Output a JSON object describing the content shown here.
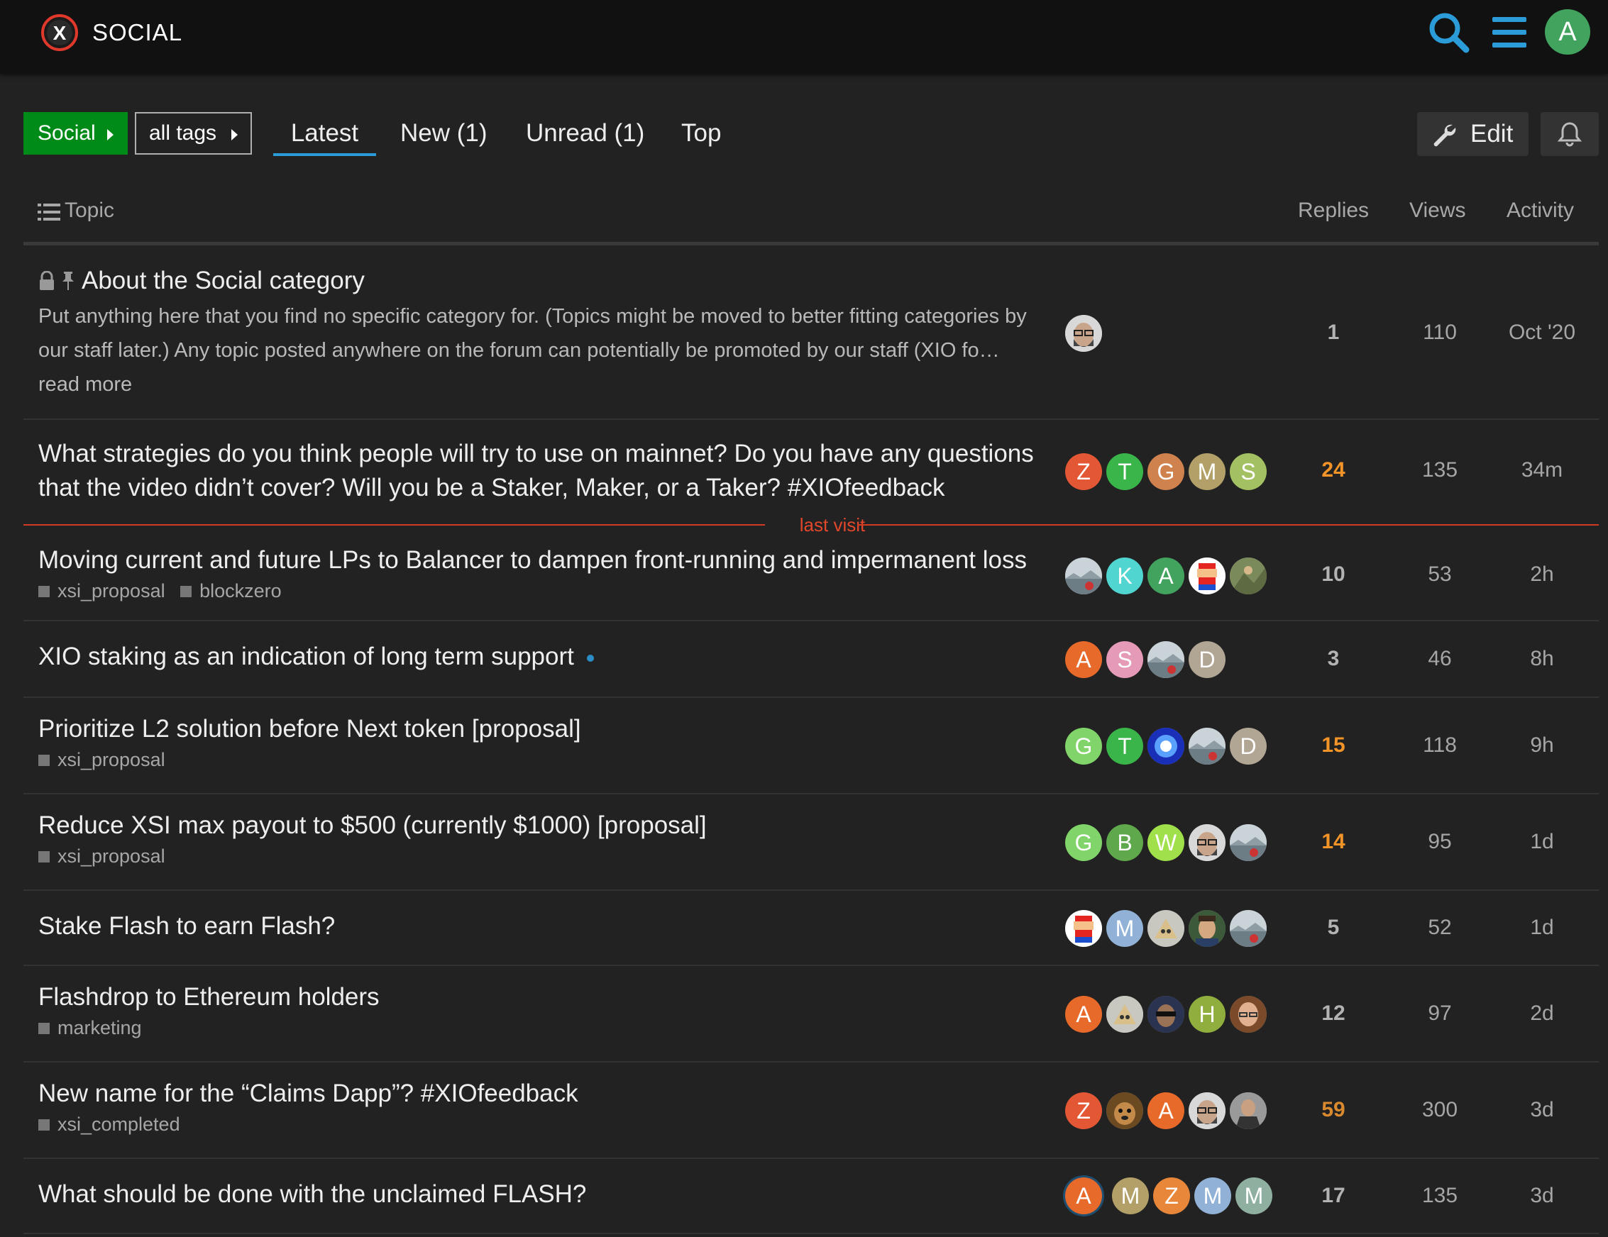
{
  "header": {
    "site_title": "SOCIAL",
    "logo_letter": "X",
    "user_initial": "A",
    "icons": [
      "search-icon",
      "hamburger-menu-icon"
    ],
    "accent_color": "#2b9cd8"
  },
  "nav": {
    "category": "Social",
    "tags": "all tags",
    "tabs": [
      "Latest",
      "New (1)",
      "Unread (1)",
      "Top"
    ],
    "active_tab": "Latest",
    "edit_label": "Edit"
  },
  "columns": {
    "topic": "Topic",
    "replies": "Replies",
    "views": "Views",
    "activity": "Activity"
  },
  "last_visit_label": "last visit",
  "topics": [
    {
      "title": "About the Social category",
      "excerpt": "Put anything here that you find no specific category for. (Topics might be moved to better fitting categories by our staff later.) Any topic posted anywhere on the forum can potentially be promoted by our staff (XIO fo… read more",
      "replies": "1",
      "views": "110",
      "activity": "Oct '20",
      "posters": [
        {
          "type": "image",
          "name": "glasses-beard-avatar"
        }
      ]
    },
    {
      "title": "What strategies do you think people will try to use on mainnet? Do you have any questions that the video didn’t cover? Will you be a Staker, Maker, or a Taker? #XIOfeedback",
      "replies": "24",
      "views": "135",
      "activity": "34m",
      "posters": [
        {
          "letter": "Z",
          "color": "#e45735"
        },
        {
          "letter": "T",
          "color": "#3ab54a"
        },
        {
          "letter": "G",
          "color": "#d0824e"
        },
        {
          "letter": "M",
          "color": "#b3a068"
        },
        {
          "letter": "S",
          "color": "#a3c163"
        }
      ]
    },
    {
      "title": "Moving current and future LPs to Balancer to dampen front-running and impermanent loss",
      "tags": [
        "xsi_proposal",
        "blockzero"
      ],
      "replies": "10",
      "views": "53",
      "activity": "2h",
      "posters": [
        {
          "type": "image",
          "name": "landscape-avatar"
        },
        {
          "letter": "K",
          "color": "#50d5d1"
        },
        {
          "letter": "A",
          "color": "#41a35e"
        },
        {
          "type": "image",
          "name": "pixel-mario-avatar"
        },
        {
          "type": "image",
          "name": "rock-climber-avatar"
        }
      ]
    },
    {
      "title": "XIO staking as an indication of long term support",
      "replies": "3",
      "views": "46",
      "activity": "8h",
      "posters": [
        {
          "letter": "A",
          "color": "#e86a2b"
        },
        {
          "letter": "S",
          "color": "#e59ab7"
        },
        {
          "type": "image",
          "name": "landscape-avatar"
        },
        {
          "letter": "D",
          "color": "#b1a593"
        }
      ]
    },
    {
      "title": "Prioritize L2 solution before Next token [proposal]",
      "tags": [
        "xsi_proposal"
      ],
      "replies": "15",
      "views": "118",
      "activity": "9h",
      "posters": [
        {
          "letter": "G",
          "color": "#81d46a"
        },
        {
          "letter": "T",
          "color": "#3ab54a"
        },
        {
          "type": "image",
          "name": "blue-swirl-avatar"
        },
        {
          "type": "image",
          "name": "landscape-avatar"
        },
        {
          "letter": "D",
          "color": "#b1a593"
        }
      ]
    },
    {
      "title": "Reduce XSI max payout to $500 (currently $1000) [proposal]",
      "tags": [
        "xsi_proposal"
      ],
      "replies": "14",
      "views": "95",
      "activity": "1d",
      "posters": [
        {
          "letter": "G",
          "color": "#81d46a"
        },
        {
          "letter": "B",
          "color": "#5fa84c"
        },
        {
          "letter": "W",
          "color": "#a0e04a"
        },
        {
          "type": "image",
          "name": "glasses-beard-avatar"
        },
        {
          "type": "image",
          "name": "landscape-avatar"
        }
      ]
    },
    {
      "title": "Stake Flash to earn Flash?",
      "replies": "5",
      "views": "52",
      "activity": "1d",
      "posters": [
        {
          "type": "image",
          "name": "pixel-mario-avatar"
        },
        {
          "letter": "M",
          "color": "#91b2d6"
        },
        {
          "type": "image",
          "name": "cartoon-avatar"
        },
        {
          "type": "image",
          "name": "man-portrait-avatar"
        },
        {
          "type": "image",
          "name": "landscape-avatar"
        }
      ]
    },
    {
      "title": "Flashdrop to Ethereum holders",
      "tags": [
        "marketing"
      ],
      "replies": "12",
      "views": "97",
      "activity": "2d",
      "posters": [
        {
          "letter": "A",
          "color": "#e86a2b"
        },
        {
          "type": "image",
          "name": "cartoon-avatar"
        },
        {
          "type": "image",
          "name": "sunglasses-avatar"
        },
        {
          "letter": "H",
          "color": "#8fae3d"
        },
        {
          "type": "image",
          "name": "bald-man-avatar"
        }
      ]
    },
    {
      "title": "New name for the “Claims Dapp”? #XIOfeedback",
      "tags": [
        "xsi_completed"
      ],
      "replies": "59",
      "views": "300",
      "activity": "3d",
      "posters": [
        {
          "letter": "Z",
          "color": "#e45735"
        },
        {
          "type": "image",
          "name": "dog-avatar"
        },
        {
          "letter": "A",
          "color": "#e86a2b"
        },
        {
          "type": "image",
          "name": "glasses-beard-avatar"
        },
        {
          "type": "image",
          "name": "suit-man-avatar"
        }
      ]
    },
    {
      "title": "What should be done with the unclaimed FLASH?",
      "replies": "17",
      "views": "135",
      "activity": "3d",
      "posters": [
        {
          "letter": "A",
          "color": "#e86a2b"
        },
        {
          "letter": "M",
          "color": "#b3a068"
        },
        {
          "letter": "Z",
          "color": "#e8873a"
        },
        {
          "letter": "M",
          "color": "#91b2d6"
        },
        {
          "letter": "M",
          "color": "#8fb0a0"
        }
      ]
    }
  ]
}
